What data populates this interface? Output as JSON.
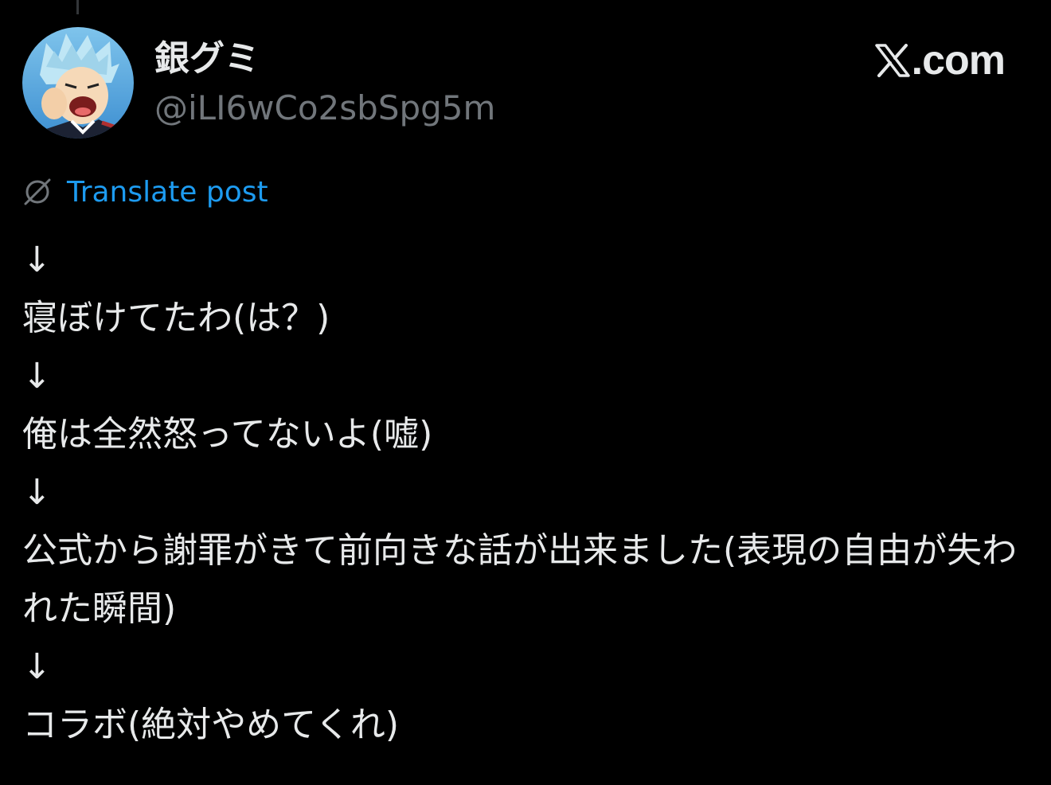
{
  "post": {
    "author": {
      "display_name": "銀グミ",
      "handle": "@iLI6wCo2sbSpg5m"
    },
    "brand": {
      "text": ".com",
      "logo_icon": "x-logo-icon"
    },
    "translate": {
      "label": "Translate post",
      "icon": "globe-slash-icon"
    },
    "lines": [
      "↓",
      "寝ぼけてたわ(は？)",
      "↓",
      "俺は全然怒ってないよ(嘘)",
      "↓",
      "公式から謝罪がきて前向きな話が出来ました(表現の自由が失われた瞬間)",
      "↓",
      "コラボ(絶対やめてくれ)"
    ],
    "colors": {
      "background": "#000000",
      "text": "#e7e9ea",
      "secondary": "#71767b",
      "link": "#1d9bf0"
    }
  }
}
